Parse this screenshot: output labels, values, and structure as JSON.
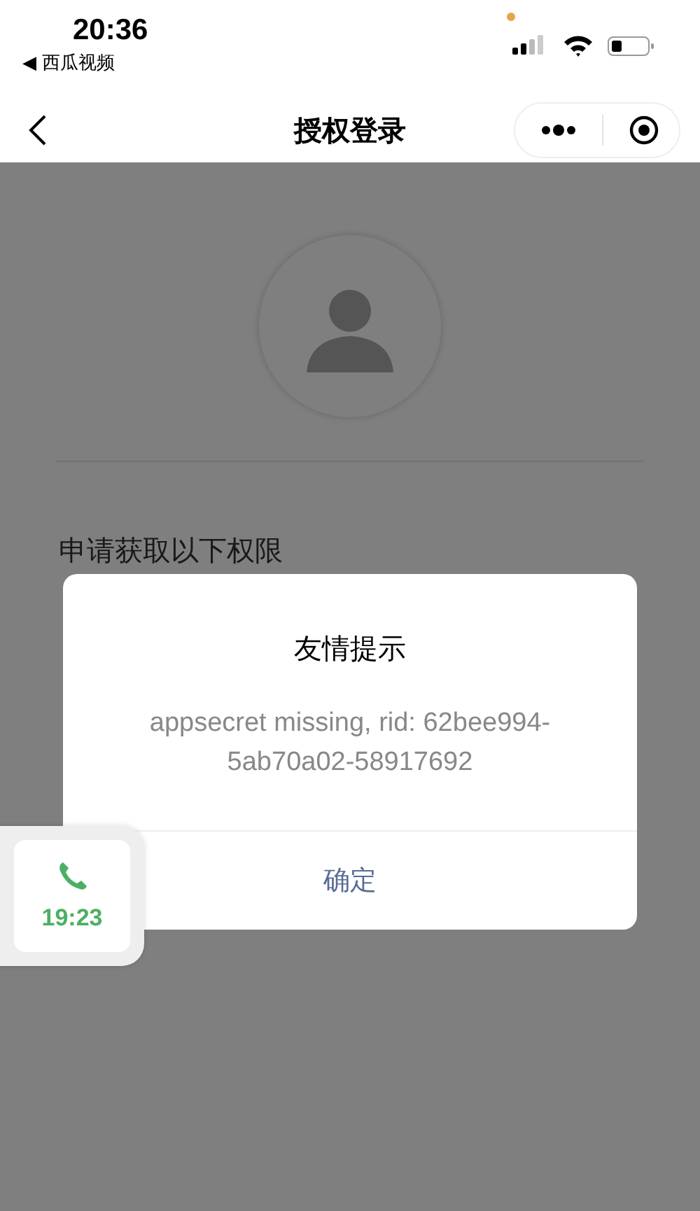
{
  "status_bar": {
    "time": "20:36",
    "back_app": "◀ 西瓜视频"
  },
  "nav_bar": {
    "title": "授权登录"
  },
  "page": {
    "permission_heading": "申请获取以下权限"
  },
  "dialog": {
    "title": "友情提示",
    "message": "appsecret missing, rid: 62bee994-5ab70a02-58917692",
    "buttons": [
      "确定"
    ]
  },
  "call_float": {
    "duration": "19:23"
  }
}
